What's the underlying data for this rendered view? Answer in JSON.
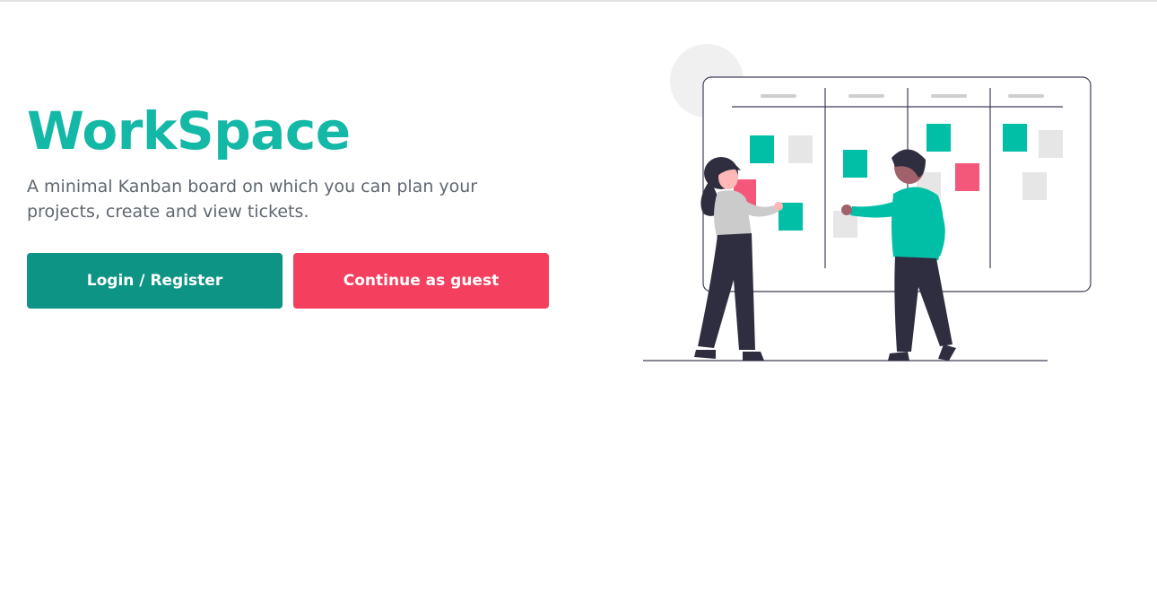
{
  "hero": {
    "title": "WorkSpace",
    "description": "A minimal Kanban board on which you can plan your projects, create and view tickets."
  },
  "actions": {
    "login_label": "Login / Register",
    "guest_label": "Continue as guest"
  },
  "colors": {
    "brand": "#14b8a6",
    "login_button": "#0e9484",
    "guest_button": "#f43f5e",
    "text_muted": "#5f6771"
  },
  "illustration": {
    "icon": "kanban-board-illustration"
  }
}
